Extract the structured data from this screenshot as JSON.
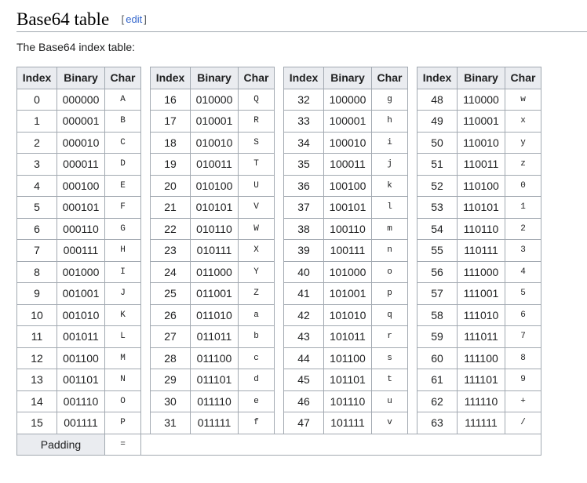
{
  "heading": {
    "title": "Base64 table",
    "edit_open": "[",
    "edit_label": "edit",
    "edit_close": "]"
  },
  "intro": "The Base64 index table:",
  "table": {
    "headers": {
      "index": "Index",
      "binary": "Binary",
      "char": "Char"
    },
    "groups": [
      {
        "rows": [
          [
            "0",
            "000000",
            "A"
          ],
          [
            "1",
            "000001",
            "B"
          ],
          [
            "2",
            "000010",
            "C"
          ],
          [
            "3",
            "000011",
            "D"
          ],
          [
            "4",
            "000100",
            "E"
          ],
          [
            "5",
            "000101",
            "F"
          ],
          [
            "6",
            "000110",
            "G"
          ],
          [
            "7",
            "000111",
            "H"
          ],
          [
            "8",
            "001000",
            "I"
          ],
          [
            "9",
            "001001",
            "J"
          ],
          [
            "10",
            "001010",
            "K"
          ],
          [
            "11",
            "001011",
            "L"
          ],
          [
            "12",
            "001100",
            "M"
          ],
          [
            "13",
            "001101",
            "N"
          ],
          [
            "14",
            "001110",
            "O"
          ],
          [
            "15",
            "001111",
            "P"
          ]
        ]
      },
      {
        "rows": [
          [
            "16",
            "010000",
            "Q"
          ],
          [
            "17",
            "010001",
            "R"
          ],
          [
            "18",
            "010010",
            "S"
          ],
          [
            "19",
            "010011",
            "T"
          ],
          [
            "20",
            "010100",
            "U"
          ],
          [
            "21",
            "010101",
            "V"
          ],
          [
            "22",
            "010110",
            "W"
          ],
          [
            "23",
            "010111",
            "X"
          ],
          [
            "24",
            "011000",
            "Y"
          ],
          [
            "25",
            "011001",
            "Z"
          ],
          [
            "26",
            "011010",
            "a"
          ],
          [
            "27",
            "011011",
            "b"
          ],
          [
            "28",
            "011100",
            "c"
          ],
          [
            "29",
            "011101",
            "d"
          ],
          [
            "30",
            "011110",
            "e"
          ],
          [
            "31",
            "011111",
            "f"
          ]
        ]
      },
      {
        "rows": [
          [
            "32",
            "100000",
            "g"
          ],
          [
            "33",
            "100001",
            "h"
          ],
          [
            "34",
            "100010",
            "i"
          ],
          [
            "35",
            "100011",
            "j"
          ],
          [
            "36",
            "100100",
            "k"
          ],
          [
            "37",
            "100101",
            "l"
          ],
          [
            "38",
            "100110",
            "m"
          ],
          [
            "39",
            "100111",
            "n"
          ],
          [
            "40",
            "101000",
            "o"
          ],
          [
            "41",
            "101001",
            "p"
          ],
          [
            "42",
            "101010",
            "q"
          ],
          [
            "43",
            "101011",
            "r"
          ],
          [
            "44",
            "101100",
            "s"
          ],
          [
            "45",
            "101101",
            "t"
          ],
          [
            "46",
            "101110",
            "u"
          ],
          [
            "47",
            "101111",
            "v"
          ]
        ]
      },
      {
        "rows": [
          [
            "48",
            "110000",
            "w"
          ],
          [
            "49",
            "110001",
            "x"
          ],
          [
            "50",
            "110010",
            "y"
          ],
          [
            "51",
            "110011",
            "z"
          ],
          [
            "52",
            "110100",
            "0"
          ],
          [
            "53",
            "110101",
            "1"
          ],
          [
            "54",
            "110110",
            "2"
          ],
          [
            "55",
            "110111",
            "3"
          ],
          [
            "56",
            "111000",
            "4"
          ],
          [
            "57",
            "111001",
            "5"
          ],
          [
            "58",
            "111010",
            "6"
          ],
          [
            "59",
            "111011",
            "7"
          ],
          [
            "60",
            "111100",
            "8"
          ],
          [
            "61",
            "111101",
            "9"
          ],
          [
            "62",
            "111110",
            "+"
          ],
          [
            "63",
            "111111",
            "/"
          ]
        ]
      }
    ],
    "padding_label": "Padding",
    "padding_char": "="
  }
}
